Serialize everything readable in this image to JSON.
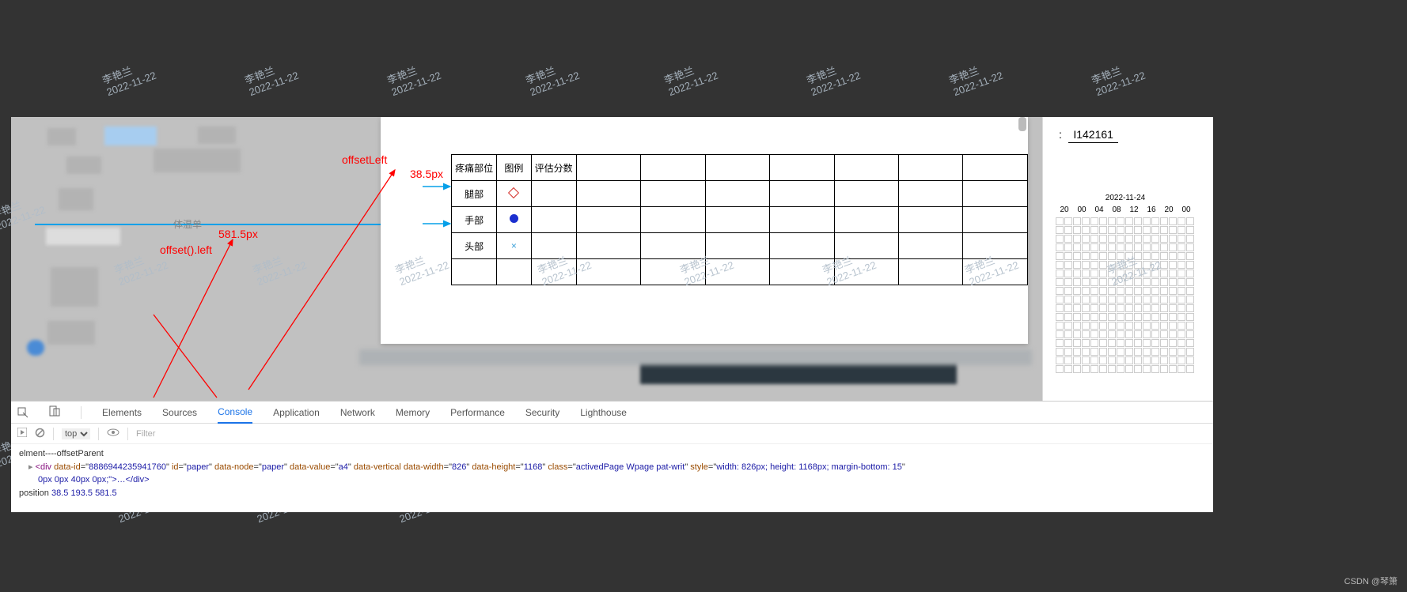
{
  "watermark": {
    "name": "李艳兰",
    "date": "2022-11-22"
  },
  "annotations": {
    "offsetLeft_label": "offsetLeft",
    "offsetLeft_value": "38.5px",
    "offset_left_label": "offset().left",
    "offset_left_value": "581.5px",
    "small_label": "体温单"
  },
  "table": {
    "headers": [
      "疼痛部位",
      "图例",
      "评估分数",
      "",
      "",
      "",
      "",
      "",
      "",
      ""
    ],
    "rows": [
      {
        "part": "腿部",
        "legend": "diamond"
      },
      {
        "part": "手部",
        "legend": "dot"
      },
      {
        "part": "头部",
        "legend": "x"
      }
    ]
  },
  "right": {
    "id_label": ":",
    "id_value": "I142161",
    "grid_date": "2022-11-24",
    "grid_hours": [
      "20",
      "00",
      "04",
      "08",
      "12",
      "16",
      "20",
      "00"
    ]
  },
  "devtools": {
    "tabs": [
      "Elements",
      "Sources",
      "Console",
      "Application",
      "Network",
      "Memory",
      "Performance",
      "Security",
      "Lighthouse"
    ],
    "active_tab": "Console",
    "ctx": "top",
    "filter_placeholder": "Filter",
    "log_line1": "elment----offsetParent",
    "log_tag_open": "<div",
    "log_attrs": [
      {
        "k": "data-id",
        "v": "8886944235941760"
      },
      {
        "k": "id",
        "v": "paper"
      },
      {
        "k": "data-node",
        "v": "paper"
      },
      {
        "k": "data-value",
        "v": "a4"
      },
      {
        "k": "data-vertical",
        "v": null
      },
      {
        "k": "data-width",
        "v": "826"
      },
      {
        "k": "data-height",
        "v": "1168"
      },
      {
        "k": "class",
        "v": "activedPage Wpage pat-writ"
      },
      {
        "k": "style",
        "v": "width: 826px; height: 1168px; margin-bottom: 15"
      }
    ],
    "log_line2b": "0px 0px 40px 0px;\">…</div>",
    "log_line3_label": "position",
    "log_line3_vals": [
      "38.5",
      "193.5",
      "581.5"
    ]
  },
  "footer": "CSDN @琴箫"
}
